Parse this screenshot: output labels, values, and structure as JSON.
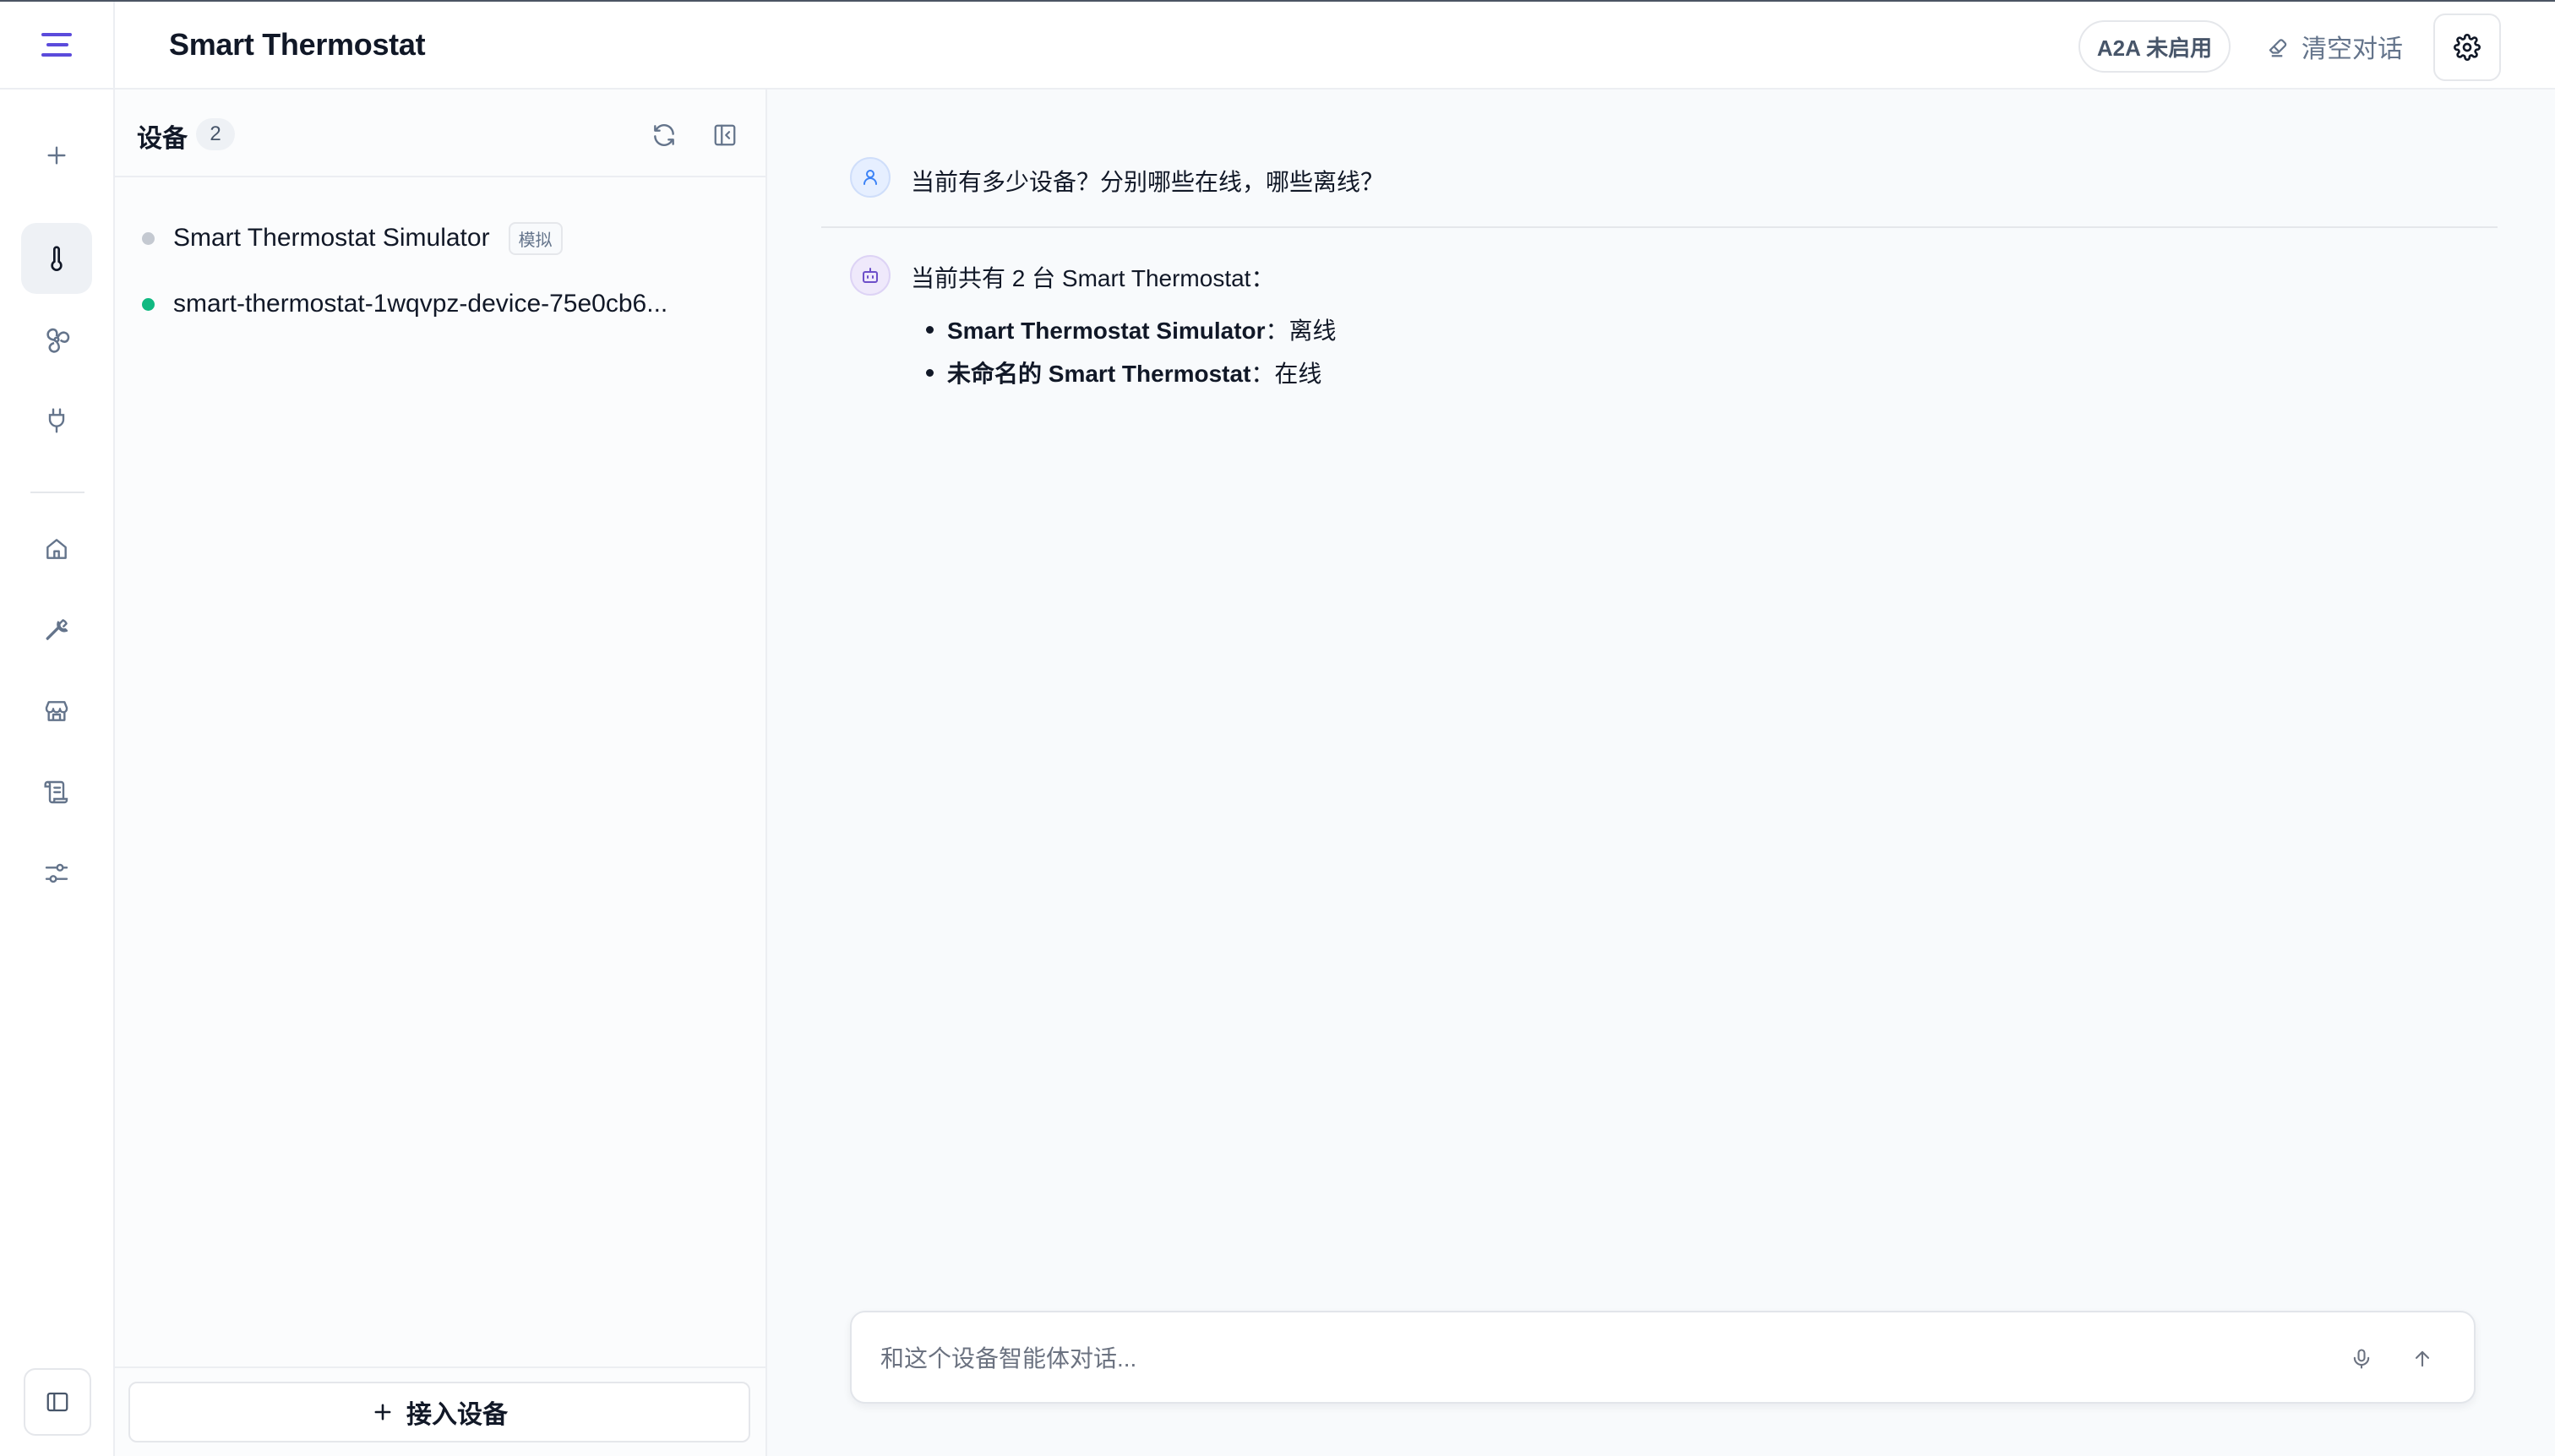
{
  "header": {
    "title": "Smart Thermostat",
    "a2a_status": "A2A 未启用",
    "clear_label": "清空对话"
  },
  "rail": {
    "items": [
      {
        "name": "new",
        "icon": "plus-icon"
      },
      {
        "name": "thermostat",
        "icon": "thermometer-icon",
        "active": true
      },
      {
        "name": "fan",
        "icon": "fan-icon"
      },
      {
        "name": "plug",
        "icon": "plug-icon"
      },
      {
        "name": "home",
        "icon": "home-icon"
      },
      {
        "name": "tools",
        "icon": "wrench-icon"
      },
      {
        "name": "store",
        "icon": "store-icon"
      },
      {
        "name": "scripts",
        "icon": "scroll-icon"
      },
      {
        "name": "settings",
        "icon": "sliders-icon"
      }
    ]
  },
  "devices": {
    "title": "设备",
    "count": "2",
    "items": [
      {
        "name": "Smart Thermostat Simulator",
        "tag": "模拟",
        "status": "offline",
        "status_color": "#c4c9d1"
      },
      {
        "name": "smart-thermostat-1wqvpz-device-75e0cb6...",
        "tag": "",
        "status": "online",
        "status_color": "#10b981"
      }
    ],
    "add_label": "接入设备"
  },
  "chat": {
    "user_message": "当前有多少设备？分别哪些在线，哪些离线？",
    "bot_intro": "当前共有 2 台 Smart Thermostat：",
    "bot_bullets": [
      {
        "bold": "Smart Thermostat Simulator",
        "rest": "：离线"
      },
      {
        "bold": "未命名的 Smart Thermostat",
        "rest": "：在线"
      }
    ],
    "input_placeholder": "和这个设备智能体对话..."
  },
  "colors": {
    "accent": "#5b4bdb",
    "online": "#10b981",
    "offline": "#c4c9d1"
  }
}
